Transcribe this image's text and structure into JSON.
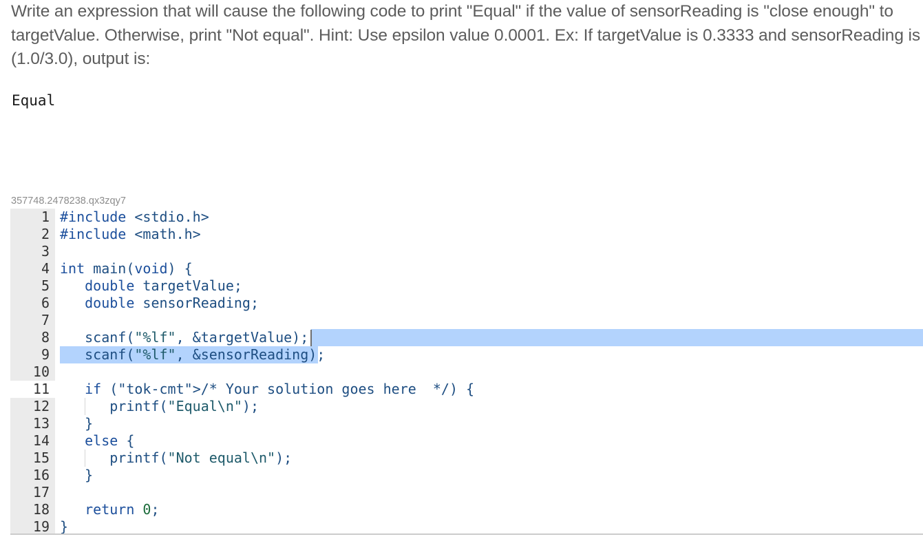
{
  "prompt": {
    "line1": "Write an expression that will cause the following code to print \"Equal\" if the value of sensorReading is \"close enough\" to",
    "line2": "targetValue. Otherwise, print \"Not equal\". Hint: Use epsilon value 0.0001. Ex: If targetValue is 0.3333 and sensorReading is",
    "line3": "(1.0/3.0), output is:"
  },
  "example_output": "Equal",
  "code_id": "357748.2478238.qx3zqy7",
  "editor": {
    "active_line": 11,
    "selection": "lines 8 (end) – 9 selected",
    "lines": [
      {
        "n": "1",
        "text": "#include <stdio.h>"
      },
      {
        "n": "2",
        "text": "#include <math.h>"
      },
      {
        "n": "3",
        "text": ""
      },
      {
        "n": "4",
        "text": "int main(void) {"
      },
      {
        "n": "5",
        "text": "   double targetValue;"
      },
      {
        "n": "6",
        "text": "   double sensorReading;"
      },
      {
        "n": "7",
        "text": ""
      },
      {
        "n": "8",
        "text": "   scanf(\"%lf\", &targetValue);"
      },
      {
        "n": "9",
        "text": "   scanf(\"%lf\", &sensorReading);"
      },
      {
        "n": "10",
        "text": ""
      },
      {
        "n": "11",
        "text": "   if (/* Your solution goes here  */) {"
      },
      {
        "n": "12",
        "text": "      printf(\"Equal\\n\");"
      },
      {
        "n": "13",
        "text": "   }"
      },
      {
        "n": "14",
        "text": "   else {"
      },
      {
        "n": "15",
        "text": "      printf(\"Not equal\\n\");"
      },
      {
        "n": "16",
        "text": "   }"
      },
      {
        "n": "17",
        "text": ""
      },
      {
        "n": "18",
        "text": "   return 0;"
      },
      {
        "n": "19",
        "text": "}"
      }
    ]
  },
  "colors": {
    "selection": "#b3d3fd",
    "gutter": "#ebebeb",
    "prompt_text": "#5c5c5c",
    "code_text": "#1e4e82"
  }
}
